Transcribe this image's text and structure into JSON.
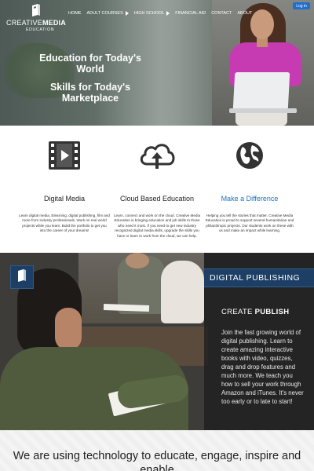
{
  "header": {
    "logo": {
      "name_light": "CREATIVE",
      "name_bold": "MEDIA",
      "sub": "EDUCATION",
      "icon": "book-icon"
    },
    "nav": [
      {
        "label": "HOME",
        "has_submenu": false
      },
      {
        "label": "ADULT COURSES",
        "has_submenu": true
      },
      {
        "label": "HIGH SCHOOL",
        "has_submenu": true
      },
      {
        "label": "FINANCIAL AID",
        "has_submenu": false
      },
      {
        "label": "CONTACT",
        "has_submenu": false
      },
      {
        "label": "ABOUT",
        "has_submenu": false
      }
    ],
    "login_label": "Log in",
    "accent": "#1f6fcf"
  },
  "hero": {
    "line1": "Education for Today's World",
    "line2": "Skills for Today's Marketplace"
  },
  "features": [
    {
      "icon": "film-strip-icon",
      "title": "Digital Media",
      "desc": "Learn digital media, Elearning, digital publishing, film and more from industry professionals. Work on real world projects while you learn. Build the portfolio to get you into the career of your dreams!"
    },
    {
      "icon": "cloud-upload-icon",
      "title": "Cloud Based Education",
      "desc": "Learn, connect and work on the cloud. Creative Media Education is bringing education and job skills to those who need it most. If you need to get new industry recognized digital media skills, upgrade the skills you have or learn to work from the cloud, we can help."
    },
    {
      "icon": "globe-icon",
      "title": "Make a Difference",
      "desc": "Helping you tell the stories that matter. Creative Media Education is proud to support several humanitarian and philanthropic projects. Our students work on these with us and make an impact while learning."
    }
  ],
  "publishing": {
    "header": "DIGITAL PUBLISHING",
    "create_light": "CREATE",
    "create_bold": "PUBLISH",
    "text": "Join the fast growing world of digital publishing.  Learn to create amazing interactive books with video, quizzes, drag and drop features and much more.  We teach you how to sell your work through Amazon and iTunes. It's never too early or to late to start!",
    "icon": "book-icon",
    "accent": "#1d3f66"
  },
  "footer": {
    "text": "We are using technology to educate, engage, inspire and enable"
  }
}
